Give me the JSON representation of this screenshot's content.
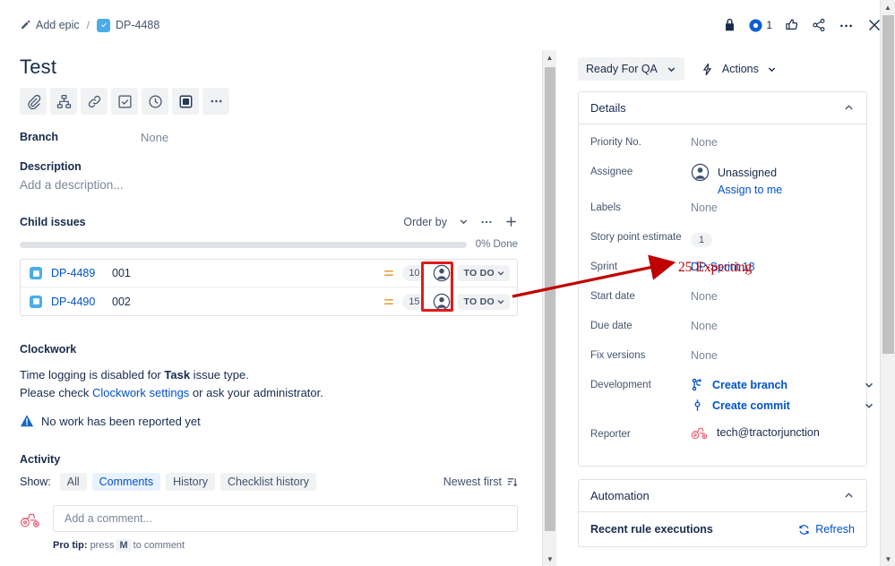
{
  "breadcrumb": {
    "add_epic": "Add epic",
    "separator": "/",
    "issue_key": "DP-4488"
  },
  "topbar": {
    "watch_count": "1",
    "icons": [
      "lock-icon",
      "watch-eye-icon",
      "like-thumbs-up-icon",
      "share-icon",
      "more-actions-icon",
      "close-icon"
    ]
  },
  "issue": {
    "title": "Test",
    "toolbar": [
      "attach-icon",
      "child-issue-icon",
      "link-icon",
      "checklist-icon",
      "clock-icon",
      "app-icon",
      "more-icon"
    ],
    "branch_label": "Branch",
    "branch_value": "None",
    "description_label": "Description",
    "description_placeholder": "Add a description..."
  },
  "child_issues": {
    "title": "Child issues",
    "order_by": "Order by",
    "progress_label": "0% Done",
    "progress_percent": 0,
    "rows": [
      {
        "key": "DP-4489",
        "summary": "001",
        "points": "10",
        "status": "TO DO"
      },
      {
        "key": "DP-4490",
        "summary": "002",
        "points": "15",
        "status": "TO DO"
      }
    ]
  },
  "clockwork": {
    "title": "Clockwork",
    "line1_pre": "Time logging is disabled for ",
    "line1_bold": "Task",
    "line1_post": " issue type.",
    "line2_pre": "Please check ",
    "line2_link": "Clockwork settings",
    "line2_post": " or ask your administrator.",
    "warning": "No work has been reported yet"
  },
  "activity": {
    "title": "Activity",
    "show_label": "Show:",
    "filters": [
      {
        "label": "All",
        "active": false
      },
      {
        "label": "Comments",
        "active": true
      },
      {
        "label": "History",
        "active": false
      },
      {
        "label": "Checklist history",
        "active": false
      }
    ],
    "sort": "Newest first",
    "comment_placeholder": "Add a comment...",
    "protip_pre": "Pro tip:",
    "protip_mid": "press",
    "protip_key": "M",
    "protip_post": "to comment"
  },
  "right_panel": {
    "status": "Ready For QA",
    "actions": "Actions",
    "details": {
      "title": "Details",
      "fields": [
        {
          "label": "Priority No.",
          "value": "None"
        },
        {
          "label": "Assignee",
          "value": "Unassigned",
          "sub_link": "Assign to me"
        },
        {
          "label": "Labels",
          "value": "None"
        },
        {
          "label": "Story point estimate",
          "value": "1"
        },
        {
          "label": "Sprint",
          "value": "DP-Sprint 18"
        },
        {
          "label": "Start date",
          "value": "None"
        },
        {
          "label": "Due date",
          "value": "None"
        },
        {
          "label": "Fix versions",
          "value": "None"
        },
        {
          "label": "Development",
          "value": ""
        },
        {
          "label": "Reporter",
          "value": "tech@tractorjunction"
        }
      ],
      "development": [
        {
          "label": "Create branch",
          "icon": "branch-icon"
        },
        {
          "label": "Create commit",
          "icon": "commit-icon"
        }
      ]
    },
    "automation": {
      "title": "Automation",
      "recent": "Recent rule executions",
      "refresh": "Refresh"
    }
  },
  "annotations": {
    "callout_text": "25 Expecting",
    "highlight_color": "#e01b1b",
    "text_color": "#c00000"
  }
}
